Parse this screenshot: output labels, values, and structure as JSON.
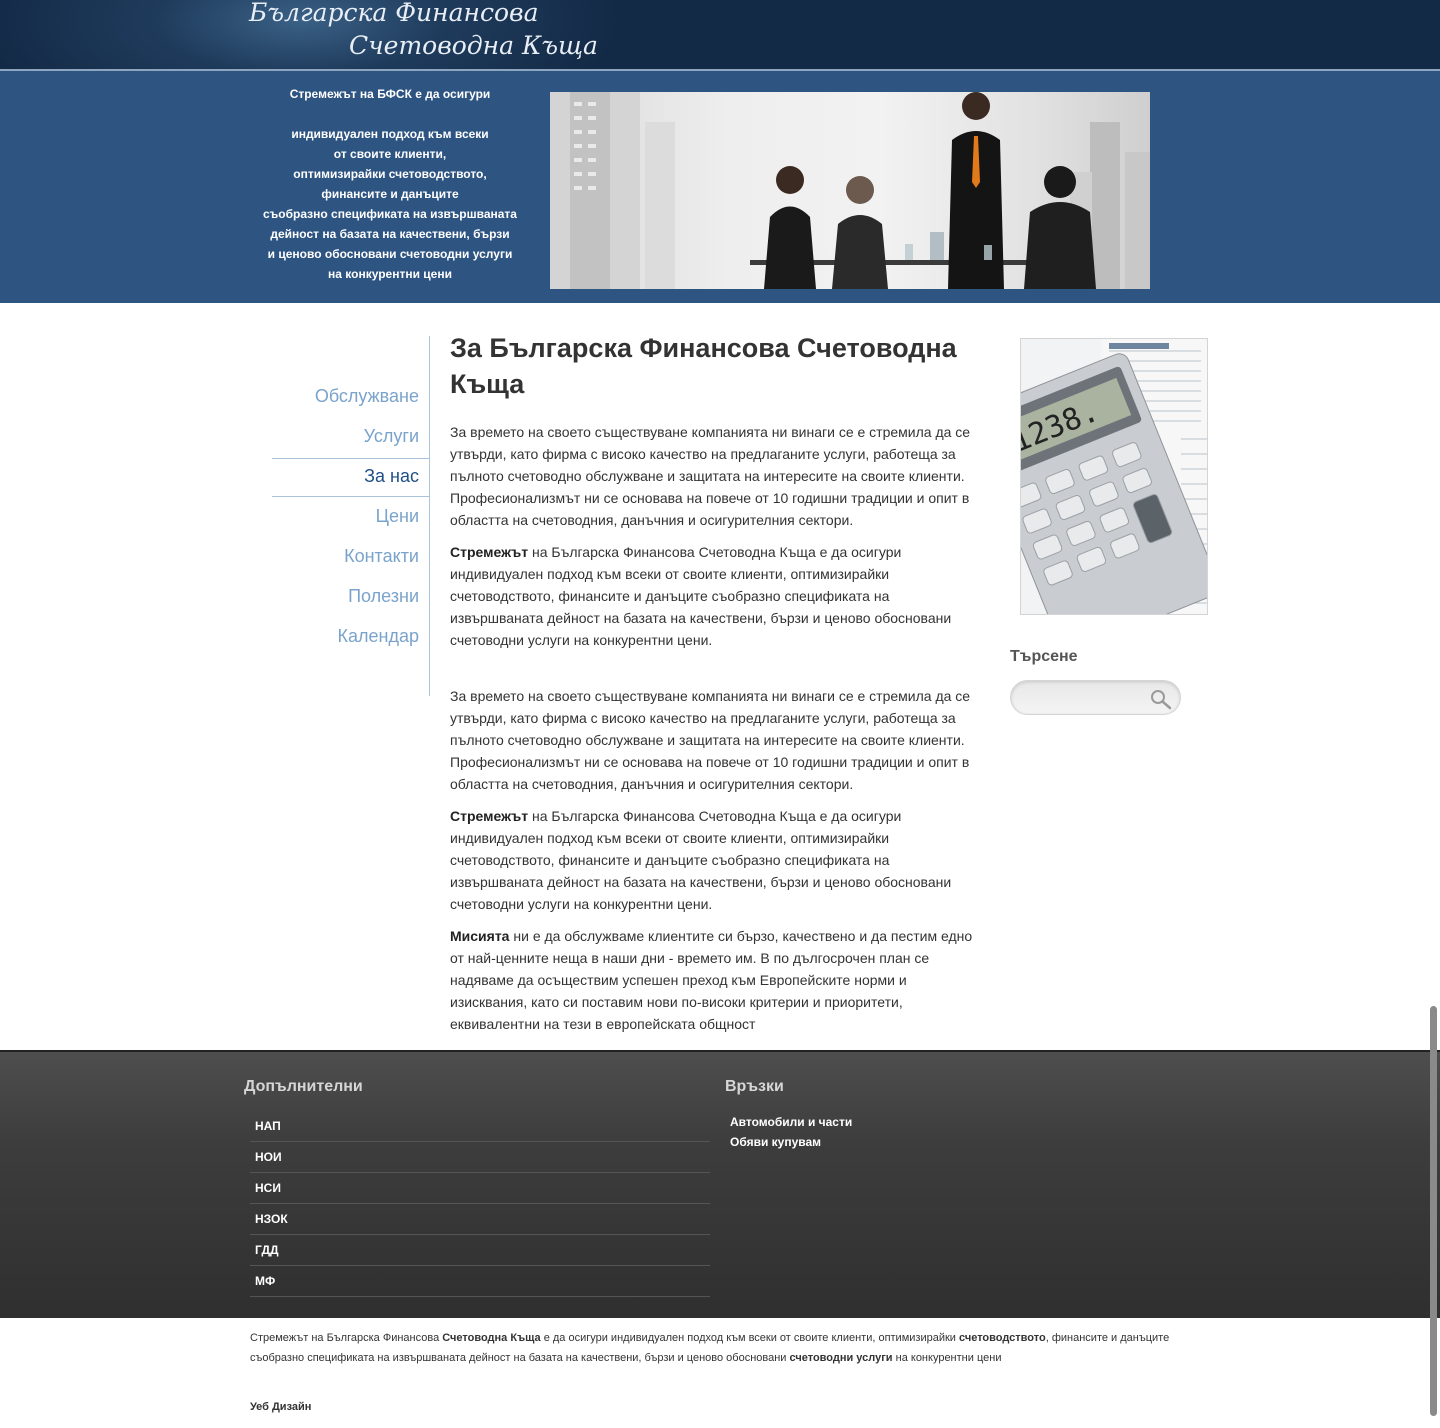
{
  "header": {
    "logo_line1": "Българска Финансова",
    "logo_line2": "Счетоводна Къща"
  },
  "banner": {
    "lines": [
      "Стремежът на БФСК е да осигури",
      "",
      "индивидуален подход към всеки",
      "от своите клиенти,",
      "оптимизирайки счетоводството,",
      "финансите и данъците",
      "съобразно спецификата на извършваната",
      "дейност на базата на качествени, бързи",
      "и ценово обосновани счетоводни услуги",
      "на конкурентни цени"
    ]
  },
  "nav": {
    "items": [
      {
        "label": "Обслужване"
      },
      {
        "label": "Услуги"
      },
      {
        "label": "За нас",
        "active": true
      },
      {
        "label": "Цени"
      },
      {
        "label": "Контакти"
      },
      {
        "label": "Полезни"
      },
      {
        "label": "Календар"
      }
    ]
  },
  "main": {
    "title": "За Българска Финансова Счетоводна Къща",
    "p1": " За времето на своето съществуване компанията ни винаги се е стремила да се утвърди, като фирма с високо качество на предлаганите услуги, работеща  за пълното счетоводно обслужване и защитата на интересите на своите клиенти. Професионализмът ни се основава на повече от 10 годишни традиции и опит  в областта на счетоводния, данъчния и осигурителния сектори.",
    "p2_bold": "Стремежът",
    "p2": " на Българска Финансова Счетоводна Къща е да осигури индивидуален подход към всеки от своите клиенти, оптимизирайки счетоводството, финансите и данъците съобразно спецификата на извършваната дейност на базата на качествени, бързи и ценово обосновани счетоводни услуги на конкурентни цени.",
    "p3": "За времето на своето съществуване компанията ни винаги се е стремила да се утвърди, като фирма с високо качество на предлаганите услуги, работеща  за пълното счетоводно обслужване и защитата на интересите на своите клиенти. Професионализмът ни се основава на повече от 10 годишни традиции и опит  в областта на счетоводния, данъчния и осигурителния сектори.",
    "p4_bold": "Стремежът",
    "p4": " на Българска Финансова Счетоводна Къща е да осигури индивидуален подход към всеки от своите клиенти, оптимизирайки счетоводството, финансите и данъците съобразно спецификата на извършваната дейност на базата на качествени, бързи и ценово обосновани счетоводни услуги на конкурентни цени.",
    "p5_bold": "Мисията",
    "p5": " ни е да обслужваме клиентите си бързо, качествено и да пестим  едно от най-ценните неща в наши дни - времето им. В по дългосрочен план се надяваме да осъществим успешен преход към Европейските норми и изисквания, като си поставим нови по-високи критерии и приоритети, еквивалентни на тези в европейската общност"
  },
  "sidebar": {
    "search_title": "Търсене",
    "search_value": "",
    "calc_display": "1238."
  },
  "footer": {
    "col1_title": "Допълнителни",
    "col1_items": [
      "НАП",
      "НОИ",
      "НСИ",
      "НЗОК",
      "ГДД",
      "МФ"
    ],
    "col2_title": "Връзки",
    "col2_items": [
      "Автомобили и части",
      "Обяви купувам"
    ]
  },
  "bottom": {
    "t1": "Стремежът на Българска Финансова ",
    "b1": "Счетоводна Къща",
    "t2": " е да осигури индивидуален подход към всеки от своите клиенти, оптимизирайки ",
    "b2": "счетоводството",
    "t3": ", финансите и данъците съобразно спецификата на извършваната дейност на базата на качествени, бързи и ценово обосновани ",
    "b3": "счетоводни услуги",
    "t4": " на конкурентни цени",
    "webdesign": "Уеб Дизайн"
  }
}
